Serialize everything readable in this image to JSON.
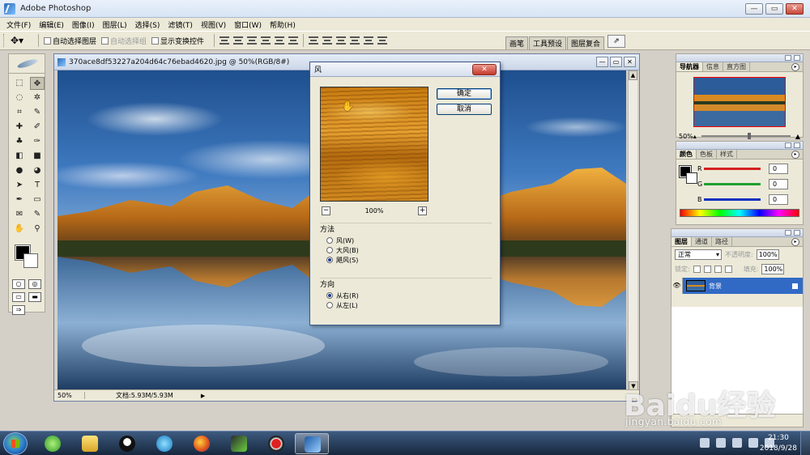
{
  "app": {
    "title": "Adobe Photoshop"
  },
  "window_buttons": {
    "minimize": "—",
    "restore": "▭",
    "close": "✕"
  },
  "menubar": {
    "items": [
      "文件(F)",
      "编辑(E)",
      "图像(I)",
      "图层(L)",
      "选择(S)",
      "滤镜(T)",
      "视图(V)",
      "窗口(W)",
      "帮助(H)"
    ]
  },
  "options": {
    "tool_preset_icon": "move-tool-icon",
    "auto_select_layer": "自动选择图层",
    "auto_select_group": "自动选择组",
    "show_transform": "显示变换控件",
    "well_tabs": [
      "画笔",
      "工具预设",
      "图层复合"
    ]
  },
  "document": {
    "title": "370ace8df53227a204d64c76ebad4620.jpg @ 50%(RGB/8#)",
    "zoom": "50%",
    "doc_size": "文档:5.93M/5.93M"
  },
  "dialog": {
    "title": "风",
    "close": "✕",
    "ok": "确定",
    "cancel": "取消",
    "preview_zoom": "100%",
    "method": {
      "label": "方法",
      "options": [
        "风(W)",
        "大风(B)",
        "飓风(S)"
      ],
      "selected_index": 2
    },
    "direction": {
      "label": "方向",
      "options": [
        "从右(R)",
        "从左(L)"
      ],
      "selected_index": 0
    }
  },
  "navigator": {
    "tabs": [
      "导航器",
      "信息",
      "直方图"
    ],
    "zoom": "50%"
  },
  "color": {
    "tabs": [
      "颜色",
      "色板",
      "样式"
    ],
    "channels": [
      {
        "label": "R",
        "value": "0",
        "color": "#d42020"
      },
      {
        "label": "G",
        "value": "0",
        "color": "#20a030"
      },
      {
        "label": "B",
        "value": "0",
        "color": "#1030c0"
      }
    ]
  },
  "layers": {
    "tabs": [
      "图层",
      "通道",
      "路径"
    ],
    "blend_mode": "正常",
    "opacity_label": "不透明度:",
    "opacity_value": "100%",
    "lock_label": "锁定:",
    "fill_label": "填充:",
    "fill_value": "100%",
    "items": [
      {
        "name": "背景",
        "selected": true
      }
    ]
  },
  "watermark": {
    "main": "Baidu经验",
    "sub": "jingyan.baidu.com"
  },
  "taskbar": {
    "clock_time": "21:30",
    "clock_date": "2018/9/28"
  },
  "colors": {
    "accent": "#316ac5",
    "dialog_border": "#3c5a8e"
  }
}
